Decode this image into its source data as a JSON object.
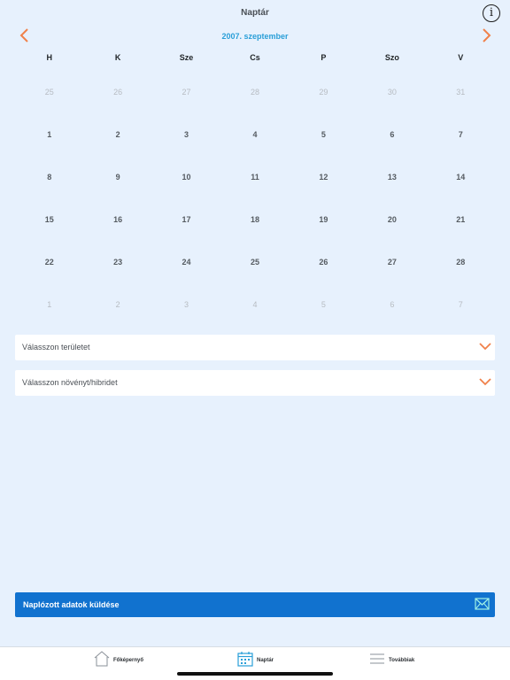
{
  "header": {
    "title": "Naptár",
    "info_glyph": "i"
  },
  "calendar": {
    "month_label": "2007. szeptember",
    "weekdays": [
      "H",
      "K",
      "Sze",
      "Cs",
      "P",
      "Szo",
      "V"
    ],
    "weeks": [
      [
        {
          "d": "25",
          "muted": true
        },
        {
          "d": "26",
          "muted": true
        },
        {
          "d": "27",
          "muted": true
        },
        {
          "d": "28",
          "muted": true
        },
        {
          "d": "29",
          "muted": true
        },
        {
          "d": "30",
          "muted": true
        },
        {
          "d": "31",
          "muted": true
        }
      ],
      [
        {
          "d": "1",
          "muted": false
        },
        {
          "d": "2",
          "muted": false
        },
        {
          "d": "3",
          "muted": false
        },
        {
          "d": "4",
          "muted": false
        },
        {
          "d": "5",
          "muted": false
        },
        {
          "d": "6",
          "muted": false
        },
        {
          "d": "7",
          "muted": false
        }
      ],
      [
        {
          "d": "8",
          "muted": false
        },
        {
          "d": "9",
          "muted": false
        },
        {
          "d": "10",
          "muted": false
        },
        {
          "d": "11",
          "muted": false
        },
        {
          "d": "12",
          "muted": false
        },
        {
          "d": "13",
          "muted": false
        },
        {
          "d": "14",
          "muted": false
        }
      ],
      [
        {
          "d": "15",
          "muted": false
        },
        {
          "d": "16",
          "muted": false
        },
        {
          "d": "17",
          "muted": false
        },
        {
          "d": "18",
          "muted": false
        },
        {
          "d": "19",
          "muted": false
        },
        {
          "d": "20",
          "muted": false
        },
        {
          "d": "21",
          "muted": false
        }
      ],
      [
        {
          "d": "22",
          "muted": false
        },
        {
          "d": "23",
          "muted": false
        },
        {
          "d": "24",
          "muted": false
        },
        {
          "d": "25",
          "muted": false
        },
        {
          "d": "26",
          "muted": false
        },
        {
          "d": "27",
          "muted": false
        },
        {
          "d": "28",
          "muted": false
        }
      ],
      [
        {
          "d": "1",
          "muted": true
        },
        {
          "d": "2",
          "muted": true
        },
        {
          "d": "3",
          "muted": true
        },
        {
          "d": "4",
          "muted": true
        },
        {
          "d": "5",
          "muted": true
        },
        {
          "d": "6",
          "muted": true
        },
        {
          "d": "7",
          "muted": true
        }
      ]
    ],
    "prev_icon": "chevron-left-icon",
    "next_icon": "chevron-right-icon"
  },
  "selects": {
    "area_placeholder": "Válasszon területet",
    "plant_placeholder": "Válasszon növényt/hibridet"
  },
  "send": {
    "label": "Naplózott adatok küldése",
    "icon": "mail-icon"
  },
  "tabbar": {
    "home": "Főképernyő",
    "calendar": "Naptár",
    "more": "Továbbiak"
  },
  "colors": {
    "background": "#e7f1fd",
    "accent_orange": "#f0814a",
    "month_blue": "#2a9fd8",
    "button_blue": "#1172cf"
  }
}
